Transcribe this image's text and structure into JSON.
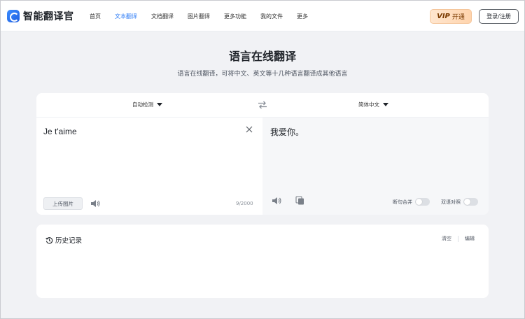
{
  "app": {
    "name": "智能翻译官"
  },
  "nav": {
    "items": [
      "首页",
      "文本翻译",
      "文档翻译",
      "图片翻译",
      "更多功能",
      "我的文件",
      "更多"
    ],
    "active_index": 1
  },
  "header": {
    "vip_label": "VIP",
    "vip_action": "开通",
    "login_label": "登录/注册"
  },
  "hero": {
    "title": "语言在线翻译",
    "subtitle": "语言在线翻译，可将中文、英文等十几种语言翻译成其他语言"
  },
  "translator": {
    "source_lang": "自动检测",
    "target_lang": "简体中文",
    "source_text": "Je t'aime",
    "char_count": "9/2000",
    "upload_label": "上传图片",
    "target_text": "我爱你。",
    "toggle_sentence": "断句合并",
    "toggle_bilingual": "双语对照"
  },
  "history": {
    "title": "历史记录",
    "clear_label": "清空",
    "edit_label": "编辑"
  },
  "colors": {
    "accent": "#2e7cf6",
    "vip_bg": "#ffd9b8",
    "page_bg": "#f1f2f5"
  },
  "icons": [
    "logo-icon",
    "caret-down-icon",
    "swap-icon",
    "close-icon",
    "speaker-icon",
    "copy-icon",
    "history-icon"
  ]
}
